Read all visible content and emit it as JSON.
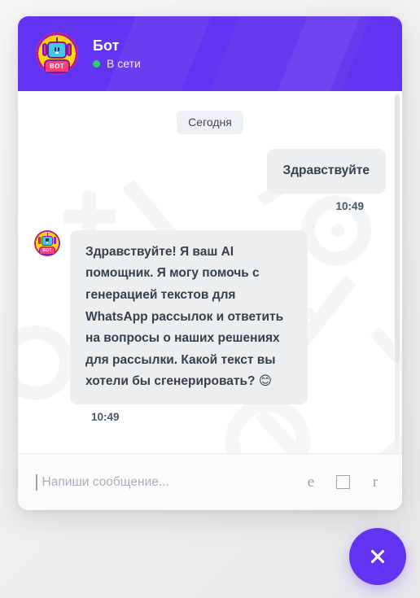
{
  "theme": {
    "brand_purple": "#6233f0",
    "online_green": "#2ecc71",
    "bubble_gray": "#eceef0",
    "date_pill_bg": "#eef1f6",
    "page_bg": "#f0f0f1",
    "text_dark": "#34414f"
  },
  "header": {
    "title": "Бот",
    "status_label": "В сети",
    "avatar_badge": "BOT",
    "avatar_icon": "robot-avatar-icon"
  },
  "chat": {
    "date_divider": "Сегодня",
    "messages": [
      {
        "id": "msg-out-1",
        "direction": "outgoing",
        "text": "Здравствуйте",
        "time": "10:49"
      },
      {
        "id": "msg-in-1",
        "direction": "incoming",
        "text": "Здравствуйте! Я ваш AI помощник. Я могу помочь с генерацией текстов для WhatsApp рассылок и ответить на вопросы о наших решениях для рассылки. Какой текст вы хотели бы сгенерировать? 😊",
        "time": "10:49",
        "avatar_badge": "BOT",
        "avatar_icon": "robot-avatar-icon"
      }
    ]
  },
  "composer": {
    "placeholder": "Напиши сообщение...",
    "value": "",
    "actions": [
      {
        "name": "emoji-button",
        "glyph": "e"
      },
      {
        "name": "attachment-button",
        "glyph": "□"
      },
      {
        "name": "send-button",
        "glyph": "r"
      }
    ]
  },
  "fab": {
    "name": "close-widget-button",
    "icon": "close-icon",
    "label": "Закрыть"
  }
}
